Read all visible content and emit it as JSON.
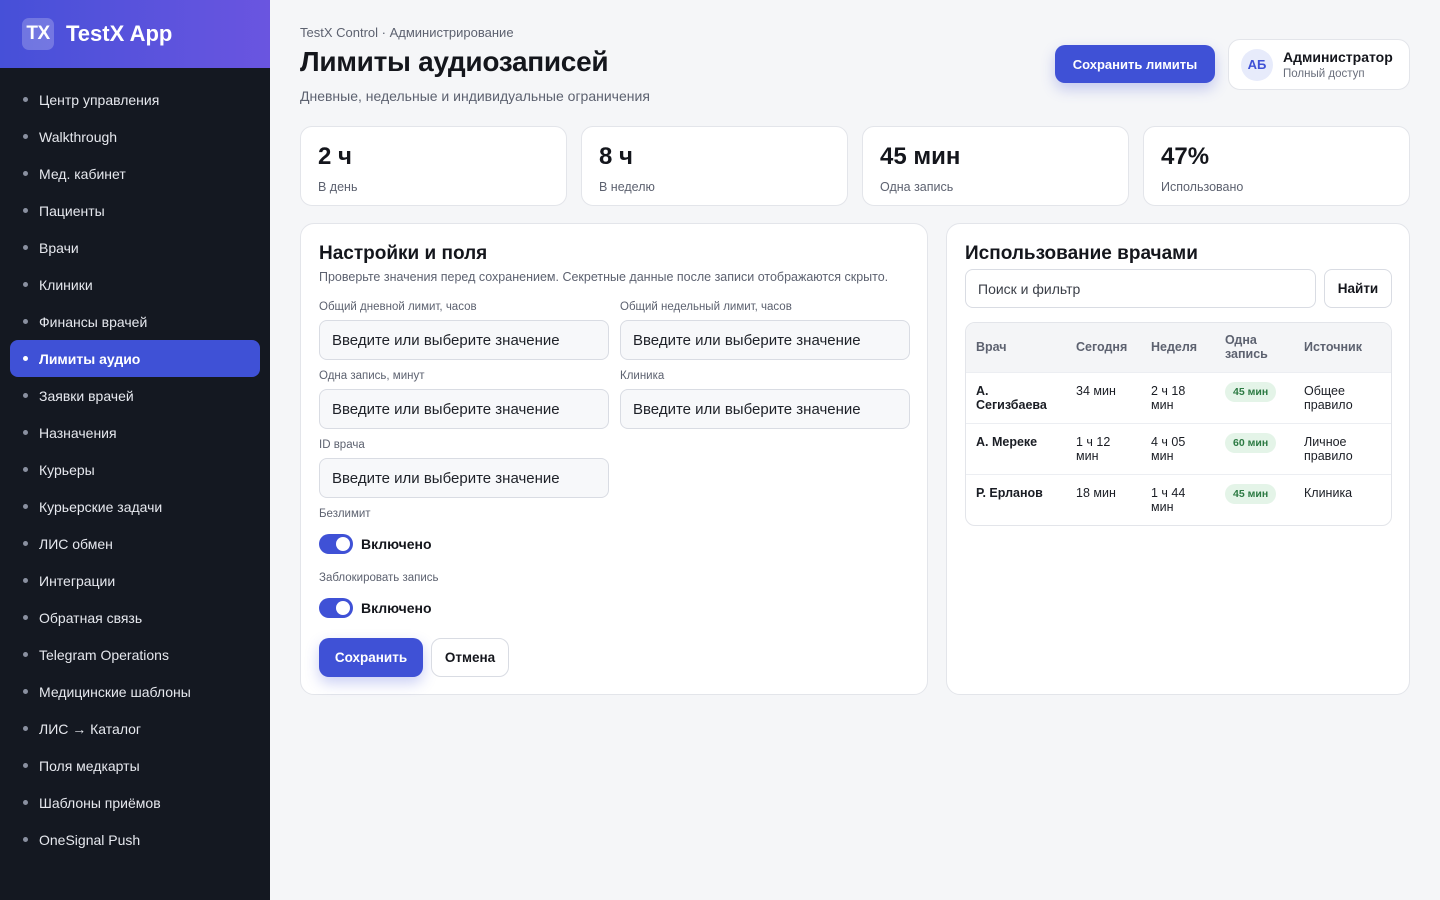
{
  "brand": {
    "logo": "TX",
    "name": "TestX App"
  },
  "sidebar": {
    "items": [
      {
        "label": "Центр управления"
      },
      {
        "label": "Walkthrough"
      },
      {
        "label": "Мед. кабинет"
      },
      {
        "label": "Пациенты"
      },
      {
        "label": "Врачи"
      },
      {
        "label": "Клиники"
      },
      {
        "label": "Финансы врачей"
      },
      {
        "label": "Лимиты аудио",
        "active": true
      },
      {
        "label": "Заявки врачей"
      },
      {
        "label": "Назначения"
      },
      {
        "label": "Курьеры"
      },
      {
        "label": "Курьерские задачи"
      },
      {
        "label": "ЛИС обмен"
      },
      {
        "label": "Интеграции"
      },
      {
        "label": "Обратная связь"
      },
      {
        "label": "Telegram Operations"
      },
      {
        "label": "Медицинские шаблоны"
      },
      {
        "label": "ЛИС → Каталог"
      },
      {
        "label": "Поля медкарты"
      },
      {
        "label": "Шаблоны приёмов"
      },
      {
        "label": "OneSignal Push"
      }
    ]
  },
  "header": {
    "breadcrumb": "TestX Control · Администрирование",
    "title": "Лимиты аудиозаписей",
    "subtitle": "Дневные, недельные и индивидуальные ограничения",
    "save_label": "Сохранить лимиты"
  },
  "user": {
    "initials": "АБ",
    "name": "Администратор",
    "role": "Полный доступ"
  },
  "stats": [
    {
      "value": "2 ч",
      "label": "В день"
    },
    {
      "value": "8 ч",
      "label": "В неделю"
    },
    {
      "value": "45 мин",
      "label": "Одна запись"
    },
    {
      "value": "47%",
      "label": "Использовано"
    }
  ],
  "settings": {
    "title": "Настройки и поля",
    "description": "Проверьте значения перед сохранением. Секретные данные после записи отображаются скрыто.",
    "fields": {
      "daily": {
        "label": "Общий дневной лимит, часов",
        "placeholder": "Введите или выберите значение"
      },
      "weekly": {
        "label": "Общий недельный лимит, часов",
        "placeholder": "Введите или выберите значение"
      },
      "single": {
        "label": "Одна запись, минут",
        "placeholder": "Введите или выберите значение"
      },
      "clinic": {
        "label": "Клиника",
        "placeholder": "Введите или выберите значение"
      },
      "doctor_id": {
        "label": "ID врача",
        "placeholder": "Введите или выберите значение"
      }
    },
    "unlimited": {
      "label": "Безлимит",
      "state": "Включено"
    },
    "block": {
      "label": "Заблокировать запись",
      "state": "Включено"
    },
    "save_label": "Сохранить",
    "cancel_label": "Отмена"
  },
  "usage": {
    "title": "Использование врачами",
    "search_placeholder": "Поиск и фильтр",
    "find_label": "Найти",
    "columns": [
      "Врач",
      "Сегодня",
      "Неделя",
      "Одна запись",
      "Источник"
    ],
    "rows": [
      {
        "doctor": "А. Сегизбаева",
        "today": "34 мин",
        "week": "2 ч 18 мин",
        "single": "45 мин",
        "source": "Общее правило"
      },
      {
        "doctor": "А. Мереке",
        "today": "1 ч 12 мин",
        "week": "4 ч 05 мин",
        "single": "60 мин",
        "source": "Личное правило"
      },
      {
        "doctor": "Р. Ерланов",
        "today": "18 мин",
        "week": "1 ч 44 мин",
        "single": "45 мин",
        "source": "Клиника"
      }
    ]
  }
}
